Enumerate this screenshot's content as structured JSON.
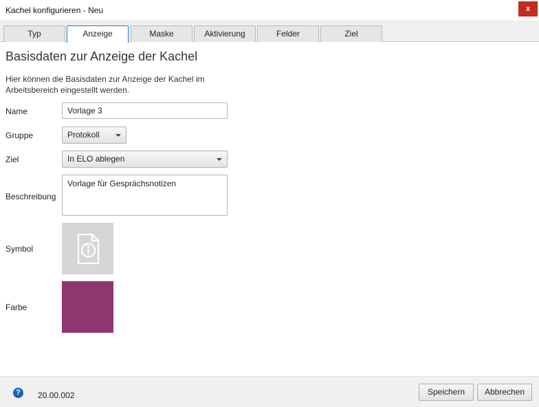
{
  "window": {
    "title": "Kachel konfigurieren - Neu",
    "close_label": "x"
  },
  "tabs": [
    {
      "label": "Typ"
    },
    {
      "label": "Anzeige",
      "active": true
    },
    {
      "label": "Maske"
    },
    {
      "label": "Aktivierung"
    },
    {
      "label": "Felder"
    },
    {
      "label": "Ziel"
    }
  ],
  "main": {
    "heading": "Basisdaten zur Anzeige der Kachel",
    "intro": "Hier können die Basisdaten zur Anzeige der Kachel im Arbeitsbereich eingestellt werden."
  },
  "form": {
    "name_label": "Name",
    "name_value": "Vorlage 3",
    "gruppe_label": "Gruppe",
    "gruppe_value": "Protokoll",
    "ziel_label": "Ziel",
    "ziel_value": "In ELO ablegen",
    "beschreibung_label": "Beschreibung",
    "beschreibung_value": "Vorlage für Gesprächsnotizen",
    "symbol_label": "Symbol",
    "symbol_icon": "document-info-icon",
    "farbe_label": "Farbe",
    "farbe_value": "#8e3670"
  },
  "footer": {
    "help_icon": "help-icon",
    "help_glyph": "?",
    "version": "20.00.002",
    "save_label": "Speichern",
    "cancel_label": "Abbrechen"
  },
  "colors": {
    "accent": "#1a7bd6",
    "close": "#c42b1c",
    "tile": "#8e3670",
    "symbol_bg": "#d6d6d6"
  }
}
